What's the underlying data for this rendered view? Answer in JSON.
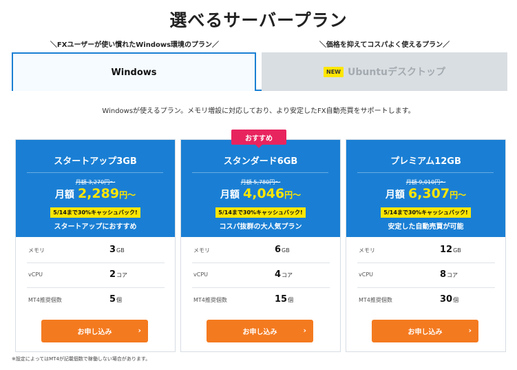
{
  "title": "選べるサーバープラン",
  "subtitles": {
    "windows": "＼FXユーザーが使い慣れたWindows環境のプラン／",
    "ubuntu": "＼価格を抑えてコスパよく使えるプラン／"
  },
  "tabs": {
    "windows": {
      "label": "Windows"
    },
    "ubuntu": {
      "badge": "NEW",
      "label": "Ubuntuデスクトップ"
    }
  },
  "description": "Windowsが使えるプラン。メモリ増設に対応しており、より安定したFX自動売買をサポートします。",
  "recommend_badge": "おすすめ",
  "plans": [
    {
      "name": "スタートアップ3GB",
      "orig_price": "月額 3,270円〜",
      "price_prefix": "月額",
      "price": "2,289",
      "price_suffix": "円〜",
      "cashback": "5/14まで30%キャッシュバック!",
      "tagline": "スタートアップにおすすめ",
      "specs": [
        {
          "label": "メモリ",
          "value": "3",
          "unit": "GB"
        },
        {
          "label": "vCPU",
          "value": "2",
          "unit": "コア"
        },
        {
          "label": "MT4推奨個数",
          "value": "5",
          "unit": "個"
        }
      ],
      "apply_label": "お申し込み"
    },
    {
      "name": "スタンダード6GB",
      "orig_price": "月額 5,780円〜",
      "price_prefix": "月額",
      "price": "4,046",
      "price_suffix": "円〜",
      "cashback": "5/14まで30%キャッシュバック!",
      "tagline": "コスパ抜群の大人気プラン",
      "specs": [
        {
          "label": "メモリ",
          "value": "6",
          "unit": "GB"
        },
        {
          "label": "vCPU",
          "value": "4",
          "unit": "コア"
        },
        {
          "label": "MT4推奨個数",
          "value": "15",
          "unit": "個"
        }
      ],
      "apply_label": "お申し込み"
    },
    {
      "name": "プレミアム12GB",
      "orig_price": "月額 9,010円〜",
      "price_prefix": "月額",
      "price": "6,307",
      "price_suffix": "円〜",
      "cashback": "5/14まで30%キャッシュバック!",
      "tagline": "安定した自動売買が可能",
      "specs": [
        {
          "label": "メモリ",
          "value": "12",
          "unit": "GB"
        },
        {
          "label": "vCPU",
          "value": "8",
          "unit": "コア"
        },
        {
          "label": "MT4推奨個数",
          "value": "30",
          "unit": "個"
        }
      ],
      "apply_label": "お申し込み"
    }
  ],
  "chevron_icon": "›",
  "footnote": "※設定によってはMT4が記載個数で稼働しない場合があります。",
  "colors": {
    "primary": "#1a7fd4",
    "accent": "#f47a1f",
    "highlight": "#ffe600",
    "badge": "#e8245f"
  }
}
